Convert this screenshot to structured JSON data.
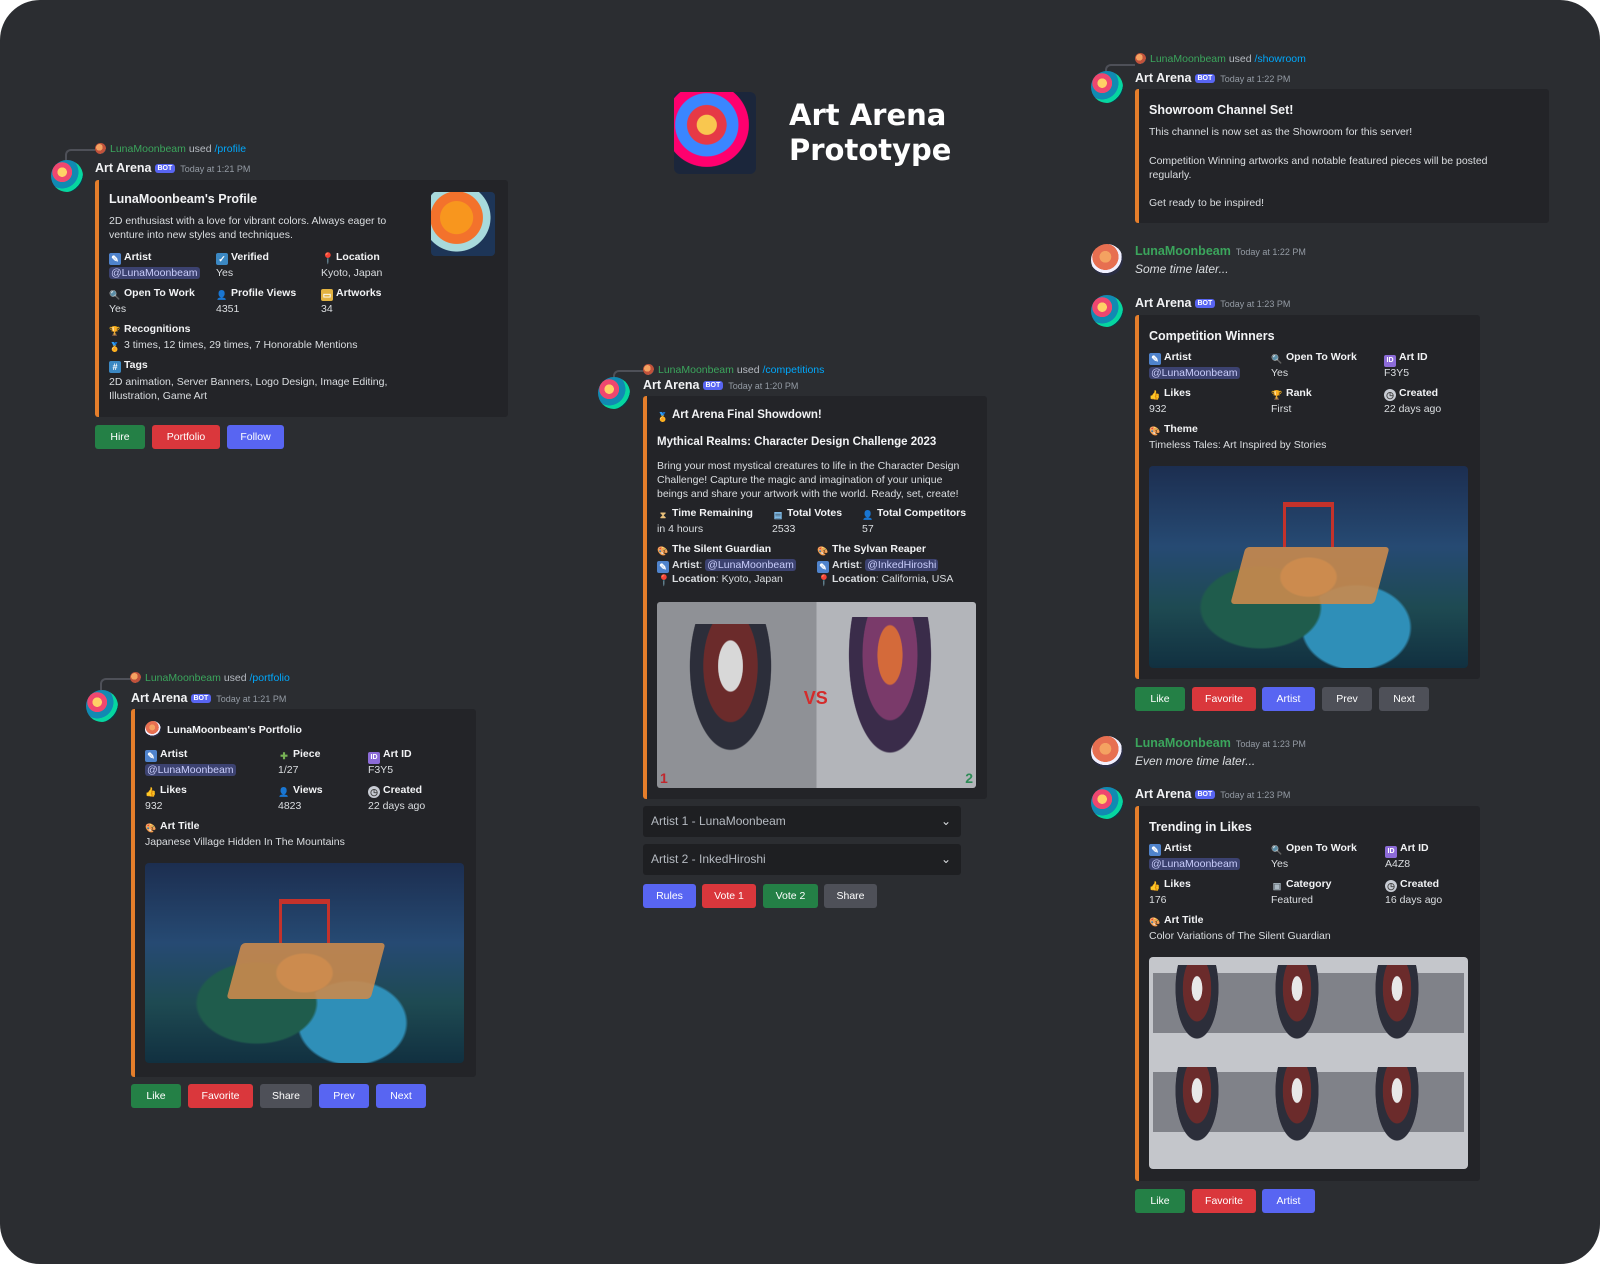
{
  "hero": {
    "title_line1": "Art Arena",
    "title_line2": "Prototype"
  },
  "common": {
    "bot_badge": "BOT",
    "bot_name": "Art Arena",
    "user_name": "LunaMoonbeam",
    "used": "used",
    "chevron": "⌄"
  },
  "profile": {
    "command": "/profile",
    "time": "Today at 1:21 PM",
    "title": "LunaMoonbeam's Profile",
    "description": "2D enthusiast with a love for vibrant colors. Always eager to venture into new styles and techniques.",
    "fields": {
      "artist_name": "Artist",
      "artist_value": "@LunaMoonbeam",
      "verified_name": "Verified",
      "verified_value": "Yes",
      "location_name": "Location",
      "location_value": "Kyoto, Japan",
      "open_name": "Open To Work",
      "open_value": "Yes",
      "views_name": "Profile Views",
      "views_value": "4351",
      "artworks_name": "Artworks",
      "artworks_value": "34",
      "recognitions_name": "Recognitions",
      "recognitions_value": "3 times, 12 times, 29 times, 7 Honorable Mentions",
      "tags_name": "Tags",
      "tags_value": "2D animation, Server Banners, Logo Design, Image Editing, Illustration, Game Art"
    },
    "buttons": [
      "Hire",
      "Portfolio",
      "Follow"
    ]
  },
  "portfolio": {
    "command": "/portfolio",
    "time": "Today at 1:21 PM",
    "title": "LunaMoonbeam's Portfolio",
    "fields": {
      "artist_name": "Artist",
      "artist_value": "@LunaMoonbeam",
      "piece_name": "Piece",
      "piece_value": "1/27",
      "artid_name": "Art ID",
      "artid_value": "F3Y5",
      "likes_name": "Likes",
      "likes_value": "932",
      "views_name": "Views",
      "views_value": "4823",
      "created_name": "Created",
      "created_value": "22 days ago",
      "arttitle_name": "Art Title",
      "arttitle_value": "Japanese Village Hidden In The Mountains"
    },
    "buttons": [
      "Like",
      "Favorite",
      "Share",
      "Prev",
      "Next"
    ]
  },
  "competition": {
    "command": "/competitions",
    "time": "Today at 1:20 PM",
    "header": "Art Arena Final Showdown!",
    "title": "Mythical Realms: Character Design Challenge 2023",
    "description": "Bring your most mystical creatures to life in the Character Design Challenge! Capture the magic and imagination of your unique beings and share your artwork with the world. Ready, set, create!",
    "fields": {
      "time_name": "Time Remaining",
      "time_value": "in 4 hours",
      "votes_name": "Total Votes",
      "votes_value": "2533",
      "competitors_name": "Total Competitors",
      "competitors_value": "57",
      "entry1_title": "The Silent Guardian",
      "entry1_artist_label": "Artist",
      "entry1_artist": "@LunaMoonbeam",
      "entry1_location_label": "Location",
      "entry1_location": "Kyoto, Japan",
      "entry2_title": "The Sylvan Reaper",
      "entry2_artist_label": "Artist",
      "entry2_artist": "@InkedHiroshi",
      "entry2_location_label": "Location",
      "entry2_location": "California, USA"
    },
    "image_vs": "VS",
    "image_n1": "1",
    "image_n2": "2",
    "select1": "Artist 1 - LunaMoonbeam",
    "select2": "Artist 2 - InkedHiroshi",
    "buttons": [
      "Rules",
      "Vote 1",
      "Vote 2",
      "Share"
    ]
  },
  "showroom": {
    "command": "/showroom",
    "time": "Today at 1:22 PM",
    "title": "Showroom Channel Set!",
    "line1": "This channel is now set as the Showroom for this server!",
    "line2": "Competition Winning artworks and notable featured pieces will be posted regularly.",
    "line3": "Get ready to be inspired!"
  },
  "later1": {
    "time": "Today at 1:22 PM",
    "text": "Some time later..."
  },
  "winners": {
    "time": "Today at 1:23 PM",
    "title": "Competition Winners",
    "fields": {
      "artist_name": "Artist",
      "artist_value": "@LunaMoonbeam",
      "open_name": "Open To Work",
      "open_value": "Yes",
      "artid_name": "Art ID",
      "artid_value": "F3Y5",
      "likes_name": "Likes",
      "likes_value": "932",
      "rank_name": "Rank",
      "rank_value": "First",
      "created_name": "Created",
      "created_value": "22 days ago",
      "theme_name": "Theme",
      "theme_value": "Timeless Tales: Art Inspired by Stories"
    },
    "buttons": [
      "Like",
      "Favorite",
      "Artist",
      "Prev",
      "Next"
    ]
  },
  "later2": {
    "time": "Today at 1:23 PM",
    "text": "Even more time later..."
  },
  "trending": {
    "time": "Today at 1:23 PM",
    "title": "Trending in Likes",
    "fields": {
      "artist_name": "Artist",
      "artist_value": "@LunaMoonbeam",
      "open_name": "Open To Work",
      "open_value": "Yes",
      "artid_name": "Art ID",
      "artid_value": "A4Z8",
      "likes_name": "Likes",
      "likes_value": "176",
      "category_name": "Category",
      "category_value": "Featured",
      "created_name": "Created",
      "created_value": "16 days ago",
      "arttitle_name": "Art Title",
      "arttitle_value": "Color Variations of The Silent Guardian"
    },
    "buttons": [
      "Like",
      "Favorite",
      "Artist"
    ]
  },
  "icons": {
    "brush": "✎",
    "check": "✓",
    "pin": "📍",
    "search": "🔍",
    "people": "👤",
    "folder": "▭",
    "trophy": "🏆",
    "hash": "#",
    "puzzle": "✚",
    "id": "ID",
    "thumb": "👍",
    "eye": "👤",
    "clock": "◷",
    "palette": "🎨",
    "hourglass": "⧗",
    "ballot": "▤",
    "medal": "🏅",
    "category": "▣"
  },
  "colors": {
    "background": "#2b2d31",
    "embed": "#232428",
    "embed_accent": "#e57e2b",
    "blurple": "#5865f2",
    "green": "#248046",
    "red": "#da373c",
    "gray": "#4e5058"
  }
}
